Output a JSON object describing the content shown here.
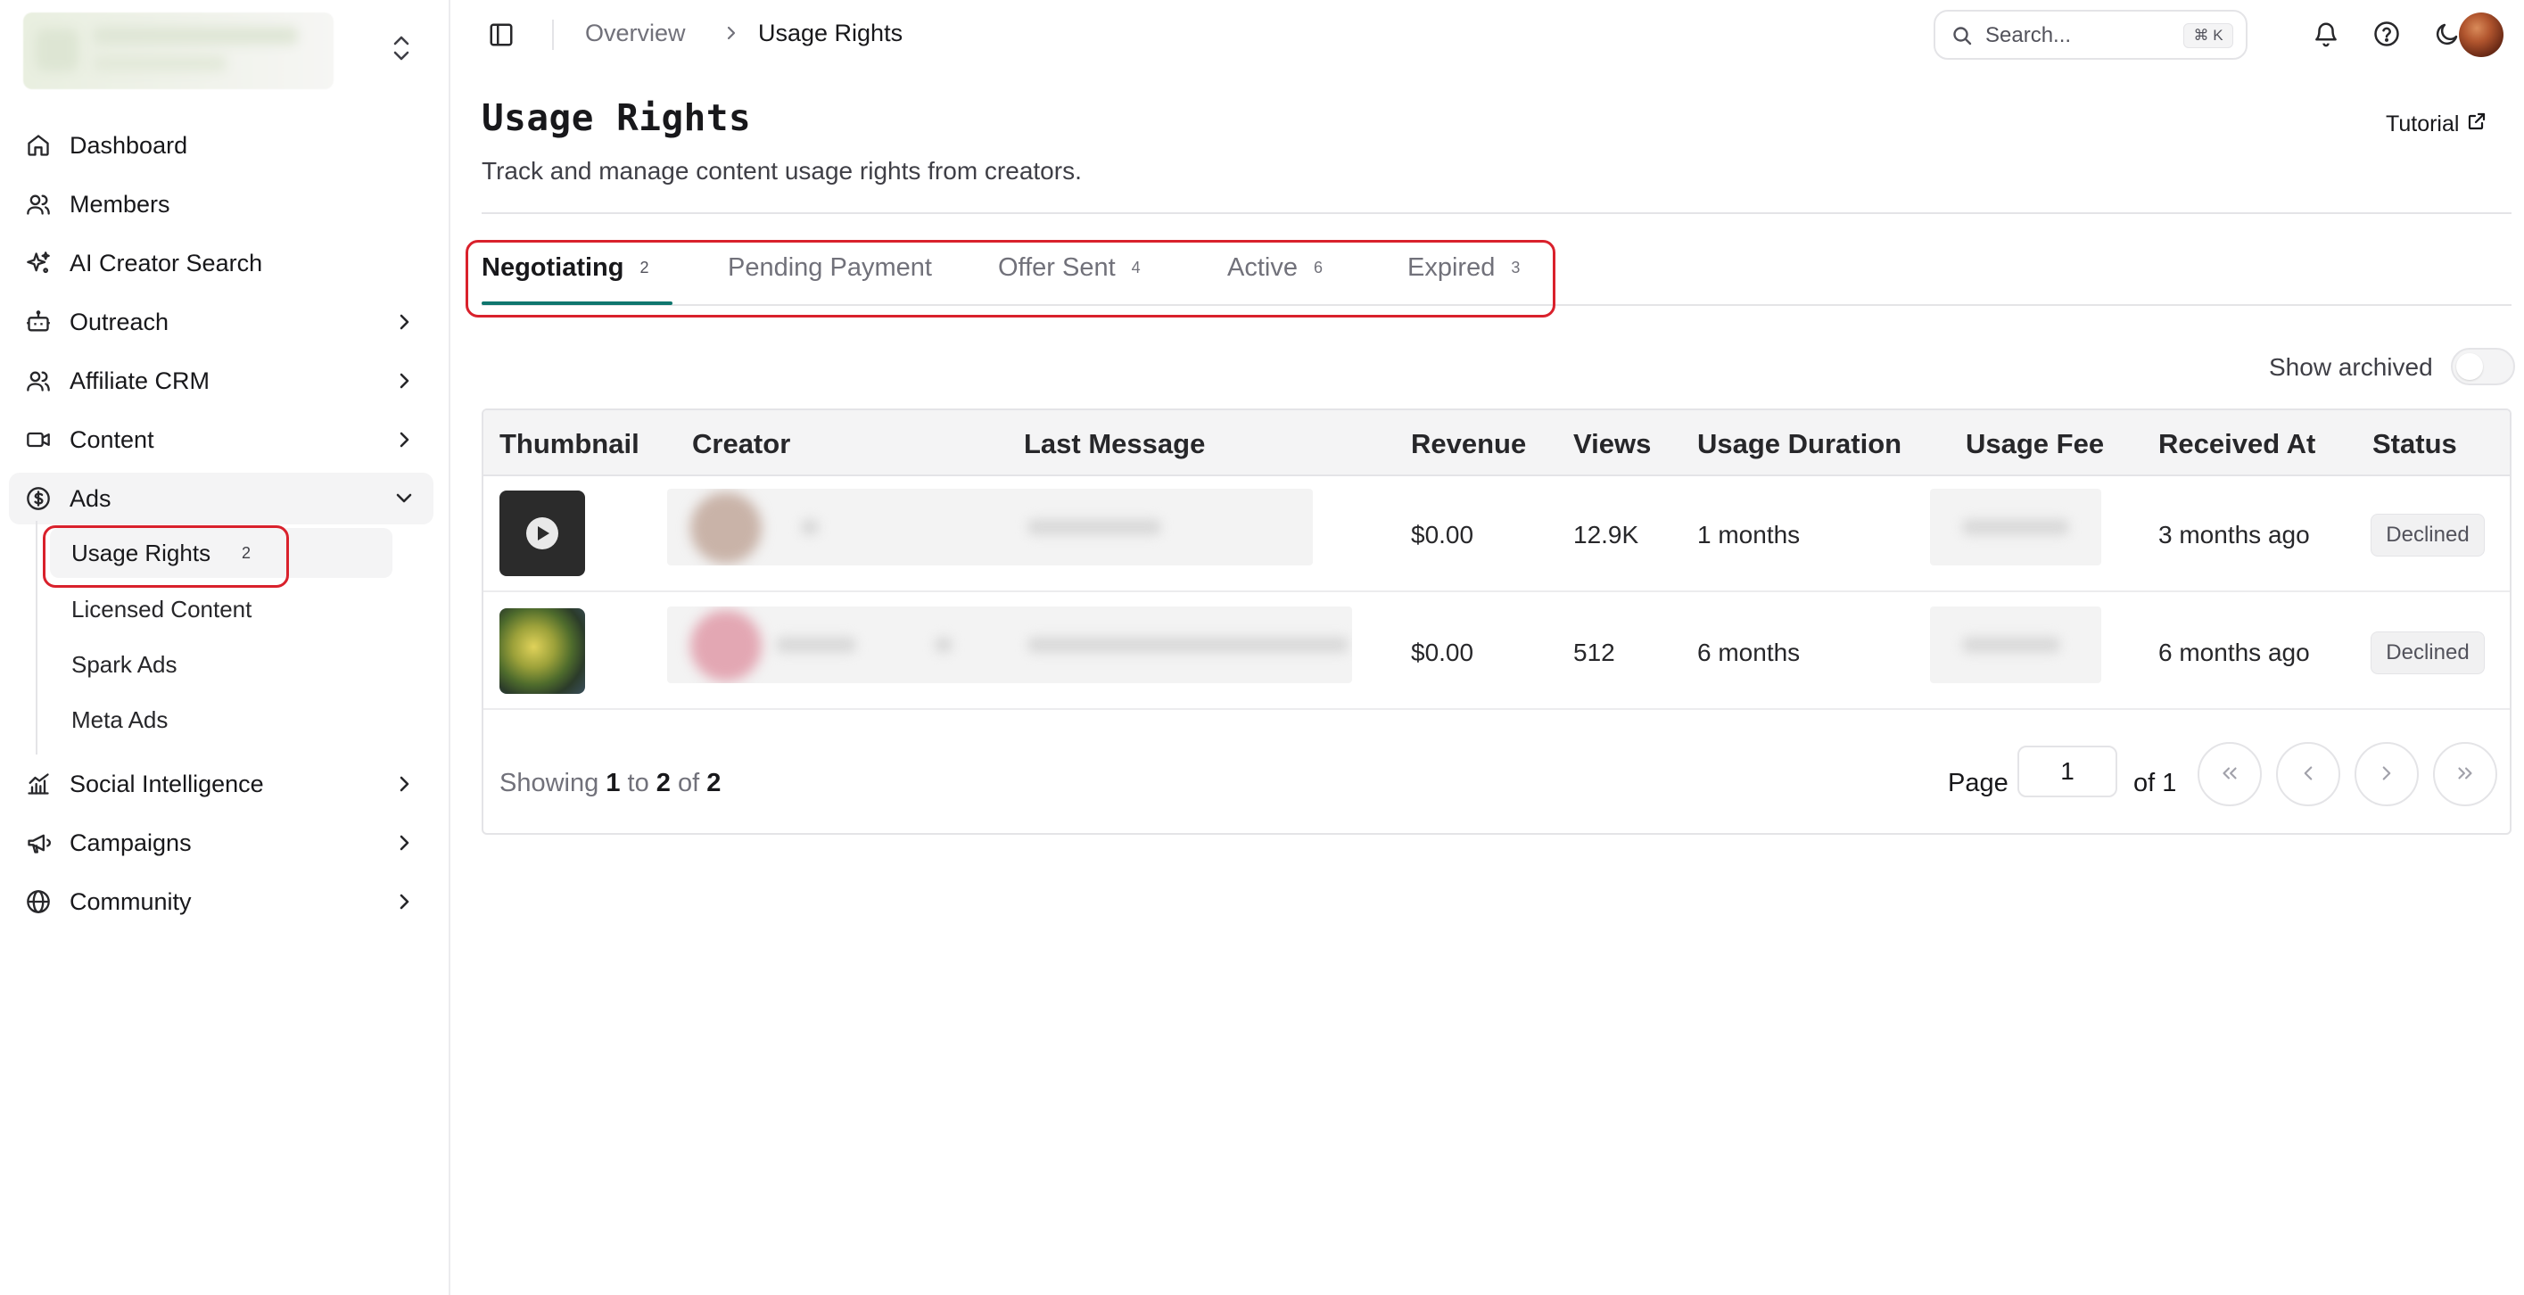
{
  "sidebar": {
    "items": [
      {
        "label": "Dashboard",
        "icon": "home-icon"
      },
      {
        "label": "Members",
        "icon": "users-icon"
      },
      {
        "label": "AI Creator Search",
        "icon": "sparkles-icon"
      },
      {
        "label": "Outreach",
        "icon": "bot-icon"
      },
      {
        "label": "Affiliate CRM",
        "icon": "users-icon"
      },
      {
        "label": "Content",
        "icon": "video-icon"
      },
      {
        "label": "Ads",
        "icon": "dollar-circle-icon"
      },
      {
        "label": "Social Intelligence",
        "icon": "chart-icon"
      },
      {
        "label": "Campaigns",
        "icon": "megaphone-icon"
      },
      {
        "label": "Community",
        "icon": "globe-icon"
      }
    ],
    "ads_subitems": [
      {
        "label": "Usage Rights",
        "badge": "2"
      },
      {
        "label": "Licensed Content"
      },
      {
        "label": "Spark Ads"
      },
      {
        "label": "Meta Ads"
      }
    ]
  },
  "topbar": {
    "breadcrumb": [
      "Overview",
      "Usage Rights"
    ],
    "search_placeholder": "Search...",
    "search_shortcut": "⌘ K"
  },
  "header": {
    "title": "Usage Rights",
    "subtitle": "Track and manage content usage rights from creators.",
    "tutorial_label": "Tutorial"
  },
  "tabs": [
    {
      "label": "Negotiating",
      "count": "2"
    },
    {
      "label": "Pending Payment",
      "count": ""
    },
    {
      "label": "Offer Sent",
      "count": "4"
    },
    {
      "label": "Active",
      "count": "6"
    },
    {
      "label": "Expired",
      "count": "3"
    }
  ],
  "archived_label": "Show archived",
  "table": {
    "columns": [
      "Thumbnail",
      "Creator",
      "Last Message",
      "Revenue",
      "Views",
      "Usage Duration",
      "Usage Fee",
      "Received At",
      "Status"
    ],
    "rows": [
      {
        "revenue": "$0.00",
        "views": "12.9K",
        "duration": "1 months",
        "received": "3 months ago",
        "status": "Declined"
      },
      {
        "revenue": "$0.00",
        "views": "512",
        "duration": "6 months",
        "received": "6 months ago",
        "status": "Declined"
      }
    ]
  },
  "footer": {
    "showing": "Showing",
    "from": "1",
    "to_word": "to",
    "to": "2",
    "of_word": "of",
    "total": "2",
    "page_label": "Page",
    "page_value": "1",
    "of_pages": "of 1"
  },
  "colors": {
    "accent_tab": "#0f766e",
    "highlight": "#d9212c"
  }
}
